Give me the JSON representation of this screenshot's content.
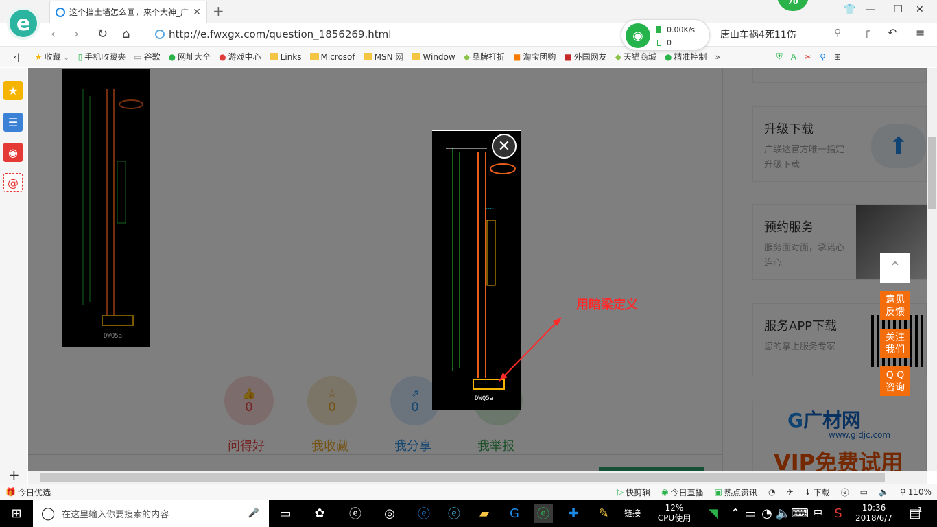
{
  "tab": {
    "title": "这个挡土墙怎么画，来个大神_广"
  },
  "badge": "70",
  "address": {
    "url": "http://e.fwxgx.com/question_1856269.html"
  },
  "network": {
    "speed_up": "0.00K/s",
    "speed_down": "0"
  },
  "search": {
    "text": "唐山车祸4死11伤"
  },
  "bookmarks": [
    "收藏",
    "手机收藏夹",
    "谷歌",
    "网址大全",
    "游戏中心",
    "Links",
    "Microsof",
    "MSN 网",
    "Window",
    "品牌打折",
    "淘宝团购",
    "外国网友",
    "天猫商城",
    "精准控制"
  ],
  "actions": [
    {
      "count": "0",
      "label": "问得好",
      "color": "#e84a4a",
      "bg": "#f9d8d8"
    },
    {
      "count": "0",
      "label": "我收藏",
      "color": "#e8a72a",
      "bg": "#f7ebcf"
    },
    {
      "count": "0",
      "label": "我分享",
      "color": "#2a8fe0",
      "bg": "#d6e9f8"
    },
    {
      "count": "",
      "label": "我举报",
      "color": "#3aa353",
      "bg": "#d8efd9"
    }
  ],
  "cards": [
    {
      "title": "升级下载",
      "desc": "广联达官方唯一指定升级下载"
    },
    {
      "title": "预约服务",
      "desc": "服务面对面，承诺心连心"
    },
    {
      "title": "服务APP下载",
      "desc": "您的掌上服务专家"
    }
  ],
  "ad": {
    "brand": "广材网",
    "url": "www.gldjc.com",
    "slogan": "VIP免费试用"
  },
  "floating": {
    "feedback": "意见\n反馈",
    "follow": "关注\n我们",
    "qq": "Q Q\n咨询"
  },
  "annotation": "用暗梁定义",
  "drawing_label": "DWQ5a",
  "statusbar": {
    "left": "今日优选",
    "items": [
      "快剪辑",
      "今日直播",
      "热点资讯"
    ],
    "download": "下载",
    "zoom": "110%"
  },
  "taskbar": {
    "search_placeholder": "在这里输入你要搜索的内容",
    "link_label": "链接",
    "cpu": "12%",
    "cpu_label": "CPU使用",
    "ime": "中",
    "time": "10:36",
    "date": "2018/6/7",
    "notifications": "1"
  }
}
